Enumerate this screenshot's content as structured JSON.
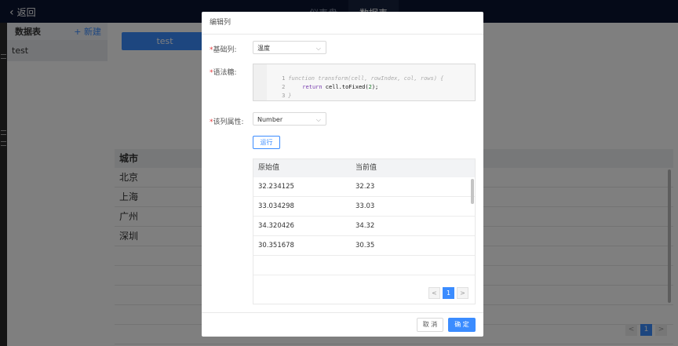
{
  "app": {
    "back_label": "返回",
    "tabs": [
      {
        "label": "仪表盘",
        "active": false
      },
      {
        "label": "数据表",
        "active": true
      }
    ]
  },
  "sidebar": {
    "title": "数据表",
    "new_label": "+ 新建",
    "items": [
      {
        "label": "test",
        "selected": true
      }
    ]
  },
  "main": {
    "table_button_label": "test",
    "columns": [
      "城市"
    ],
    "rows": [
      "北京",
      "上海",
      "广州",
      "深圳"
    ],
    "pager": {
      "prev": "<",
      "page": "1",
      "next": ">"
    }
  },
  "modal": {
    "title": "编辑列",
    "base_column": {
      "label": "基础列:",
      "required_mark": "*",
      "value": "温度"
    },
    "syntax": {
      "label": "语法糖:",
      "required_mark": "*",
      "lines": [
        {
          "n": "1",
          "text": "function transform(cell, rowIndex, col, rows) {"
        },
        {
          "n": "2",
          "text_kw": "return",
          "text_body": " cell.toFixed(",
          "text_num": "2",
          "text_end": ");"
        },
        {
          "n": "3",
          "text": "}"
        }
      ]
    },
    "column_type": {
      "label": "该列属性:",
      "required_mark": "*",
      "value": "Number"
    },
    "run_label": "运行",
    "preview": {
      "headers": [
        "原始值",
        "当前值"
      ],
      "rows": [
        [
          "32.234125",
          "32.23"
        ],
        [
          "33.034298",
          "33.03"
        ],
        [
          "34.320426",
          "34.32"
        ],
        [
          "30.351678",
          "30.35"
        ]
      ],
      "pager": {
        "prev": "<",
        "page": "1",
        "next": ">"
      }
    },
    "cancel_label": "取 消",
    "ok_label": "确 定"
  },
  "colors": {
    "primary": "#3b8cff",
    "topbar": "#0b1530",
    "required": "#e4393c"
  }
}
